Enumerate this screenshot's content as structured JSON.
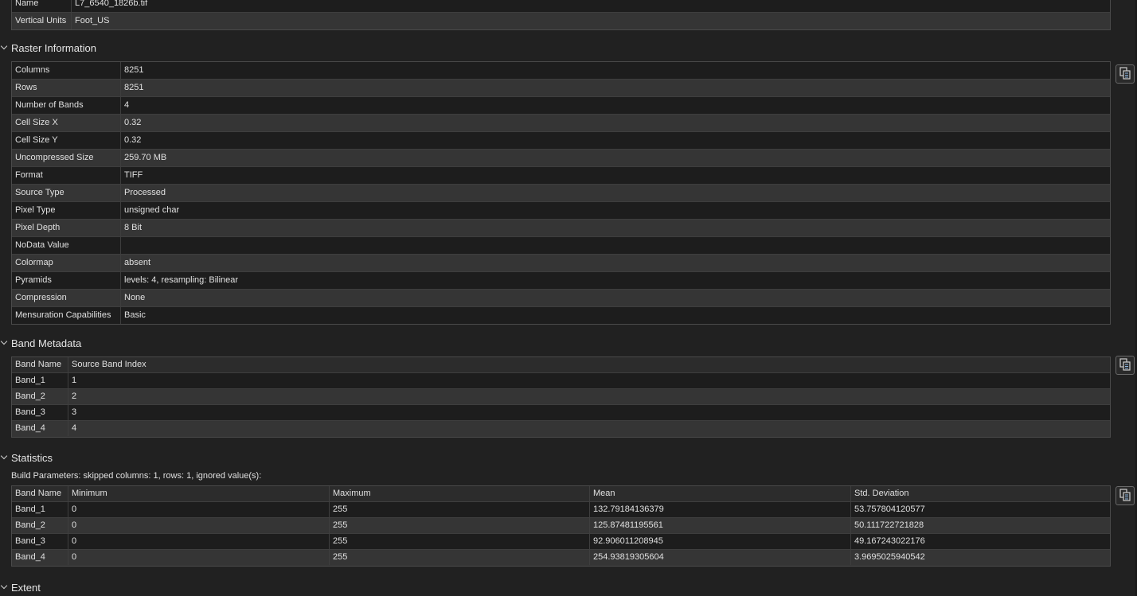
{
  "top_table": {
    "rows": [
      {
        "key": "Name",
        "value": "L7_6540_1826b.tif"
      },
      {
        "key": "Vertical Units",
        "value": "Foot_US"
      }
    ]
  },
  "raster_information": {
    "title": "Raster Information",
    "rows": [
      {
        "key": "Columns",
        "value": "8251"
      },
      {
        "key": "Rows",
        "value": "8251"
      },
      {
        "key": "Number of Bands",
        "value": "4"
      },
      {
        "key": "Cell Size X",
        "value": "0.32"
      },
      {
        "key": "Cell Size Y",
        "value": "0.32"
      },
      {
        "key": "Uncompressed Size",
        "value": "259.70 MB"
      },
      {
        "key": "Format",
        "value": "TIFF"
      },
      {
        "key": "Source Type",
        "value": "Processed"
      },
      {
        "key": "Pixel Type",
        "value": "unsigned char"
      },
      {
        "key": "Pixel Depth",
        "value": "8 Bit"
      },
      {
        "key": "NoData Value",
        "value": ""
      },
      {
        "key": "Colormap",
        "value": "absent"
      },
      {
        "key": "Pyramids",
        "value": "levels: 4, resampling: Bilinear"
      },
      {
        "key": "Compression",
        "value": "None"
      },
      {
        "key": "Mensuration Capabilities",
        "value": "Basic"
      }
    ]
  },
  "band_metadata": {
    "title": "Band Metadata",
    "headers": [
      "Band Name",
      "Source Band Index"
    ],
    "rows": [
      [
        "Band_1",
        "1"
      ],
      [
        "Band_2",
        "2"
      ],
      [
        "Band_3",
        "3"
      ],
      [
        "Band_4",
        "4"
      ]
    ]
  },
  "statistics": {
    "title": "Statistics",
    "build_parameters": "Build Parameters: skipped columns: 1, rows: 1, ignored value(s):",
    "headers": [
      "Band Name",
      "Minimum",
      "Maximum",
      "Mean",
      "Std. Deviation"
    ],
    "rows": [
      [
        "Band_1",
        "0",
        "255",
        "132.79184136379",
        "53.757804120577"
      ],
      [
        "Band_2",
        "0",
        "255",
        "125.87481195561",
        "50.111722721828"
      ],
      [
        "Band_3",
        "0",
        "255",
        "92.906011208945",
        "49.167243022176"
      ],
      [
        "Band_4",
        "0",
        "255",
        "254.93819305604",
        "3.9695025940542"
      ]
    ]
  },
  "extent": {
    "title": "Extent"
  },
  "icons": {
    "copy": "copy-icon",
    "collapse": "chevron-down-icon"
  },
  "colors": {
    "background": "#212121",
    "row_odd": "#1d1d1d",
    "row_even": "#353535",
    "text": "#e0e0e0"
  }
}
